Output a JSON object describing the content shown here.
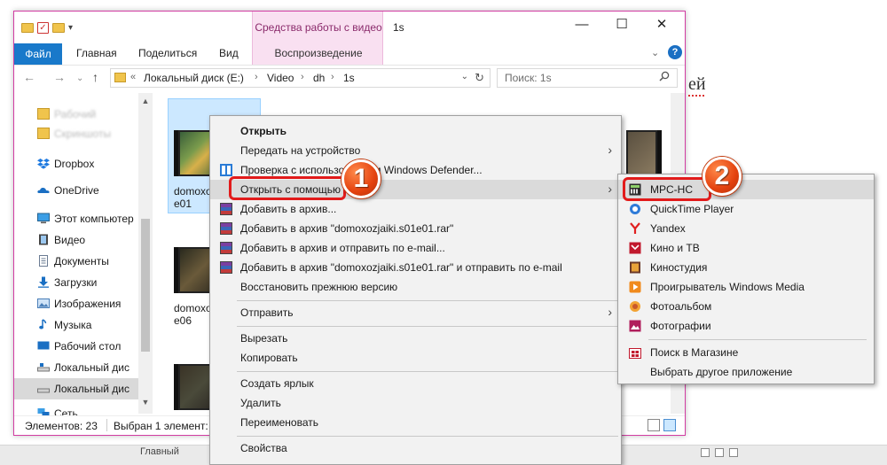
{
  "window": {
    "title": "1s",
    "context_tab_group": "Средства работы с видео",
    "context_tab": "Воспроизведение",
    "controls": {
      "minimize": "—",
      "maximize": "☐",
      "close": "✕"
    }
  },
  "ribbon": {
    "tabs": [
      "Файл",
      "Главная",
      "Поделиться",
      "Вид"
    ],
    "expand": "⌄"
  },
  "nav": {
    "back": "←",
    "forward": "→",
    "recent": "⌄",
    "up": "↑"
  },
  "address": {
    "overflow": "«",
    "crumbs": [
      "Локальный диск (E:)",
      "Video",
      "dh",
      "1s"
    ],
    "sep": "›",
    "dropdown": "⌄",
    "refresh": "↻"
  },
  "search": {
    "placeholder": "Поиск: 1s"
  },
  "navpane": {
    "items": [
      {
        "label": "Рабочий",
        "icon": "folder-icon",
        "blurred": true
      },
      {
        "label": "Скриншоты",
        "icon": "folder-icon",
        "blurred": true
      },
      {
        "label": "Dropbox",
        "icon": "dropbox-icon"
      },
      {
        "label": "OneDrive",
        "icon": "onedrive-icon"
      },
      {
        "label": "Этот компьютер",
        "icon": "computer-icon"
      },
      {
        "label": "Видео",
        "icon": "video-icon"
      },
      {
        "label": "Документы",
        "icon": "documents-icon"
      },
      {
        "label": "Загрузки",
        "icon": "downloads-icon"
      },
      {
        "label": "Изображения",
        "icon": "pictures-icon"
      },
      {
        "label": "Музыка",
        "icon": "music-icon"
      },
      {
        "label": "Рабочий стол",
        "icon": "desktop-icon"
      },
      {
        "label": "Локальный дис",
        "icon": "drive-icon"
      },
      {
        "label": "Локальный дис",
        "icon": "drive-icon",
        "selected": true
      },
      {
        "label": "Сеть",
        "icon": "network-icon"
      }
    ]
  },
  "files": [
    {
      "line1": "domoxo",
      "line2": "e01"
    },
    {
      "line1": "domoxo",
      "line2": "e06"
    }
  ],
  "status": {
    "count": "Элементов: 23",
    "selected": "Выбран 1 элемент:"
  },
  "context_menu": {
    "items": [
      {
        "label": "Открыть",
        "bold": true
      },
      {
        "label": "Передать на устройство",
        "submenu": true
      },
      {
        "label": "Проверка с использованием Windows Defender...",
        "icon": "defender-icon"
      },
      {
        "label": "Открыть с помощью",
        "submenu": true,
        "highlighted": true
      },
      {
        "label": "Добавить в архив...",
        "icon": "winrar-icon"
      },
      {
        "label": "Добавить в архив \"domoxozjaiki.s01e01.rar\"",
        "icon": "winrar-icon"
      },
      {
        "label": "Добавить в архив и отправить по e-mail...",
        "icon": "winrar-icon"
      },
      {
        "label": "Добавить в архив \"domoxozjaiki.s01e01.rar\" и отправить по e-mail",
        "icon": "winrar-icon"
      },
      {
        "label": "Восстановить прежнюю версию"
      },
      {
        "label": "Отправить",
        "submenu": true
      },
      {
        "label": "Вырезать"
      },
      {
        "label": "Копировать"
      },
      {
        "label": "Создать ярлык"
      },
      {
        "label": "Удалить"
      },
      {
        "label": "Переименовать"
      },
      {
        "label": "Свойства"
      }
    ],
    "submenu_arrow": "›"
  },
  "open_with": {
    "items": [
      {
        "label": "MPC-HC",
        "icon": "mpc-hc-icon",
        "highlighted": true
      },
      {
        "label": "QuickTime Player",
        "icon": "quicktime-icon"
      },
      {
        "label": "Yandex",
        "icon": "yandex-icon"
      },
      {
        "label": "Кино и ТВ",
        "icon": "movies-tv-icon"
      },
      {
        "label": "Киностудия",
        "icon": "movie-maker-icon"
      },
      {
        "label": "Проигрыватель Windows Media",
        "icon": "windows-media-icon"
      },
      {
        "label": "Фотоальбом",
        "icon": "photo-gallery-icon"
      },
      {
        "label": "Фотографии",
        "icon": "photos-icon"
      },
      {
        "label": "Поиск в Магазине",
        "icon": "store-icon"
      },
      {
        "label": "Выбрать другое приложение"
      }
    ]
  },
  "callouts": [
    "1",
    "2"
  ],
  "background": {
    "doc_snippet": "ей",
    "status_text": "Главный"
  },
  "colors": {
    "accent": "#1979ca",
    "window_border": "#d23da3",
    "callout_red": "#e21b1b",
    "callout_orange": "#e4420f"
  }
}
